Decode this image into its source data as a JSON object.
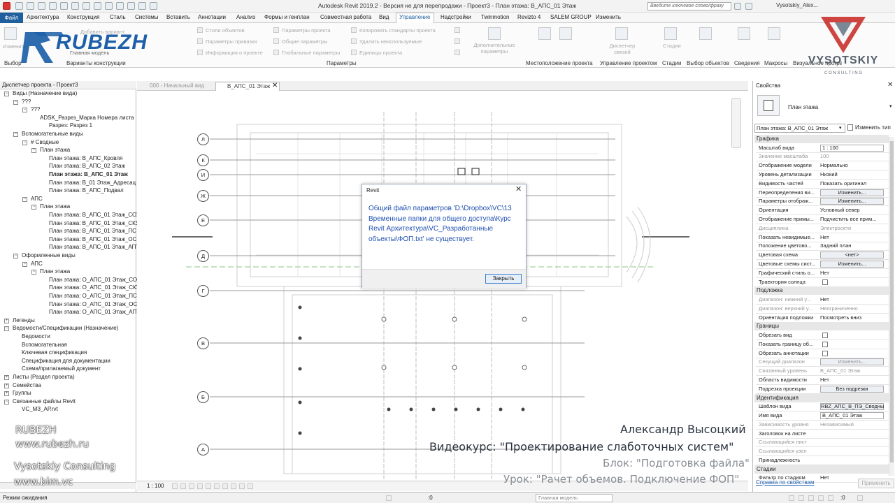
{
  "window": {
    "title": "Autodesk Revit 2019.2 - Версия не для перепродажи - Проект3 - План этажа: В_АПС_01 Этаж",
    "search_placeholder": "Введите ключевое слово/фразу",
    "user": "Vysotskiy_Alex..."
  },
  "menu": {
    "file": "Файл",
    "tabs": [
      "Архитектура",
      "Конструкция",
      "Сталь",
      "Системы",
      "Вставить",
      "Аннотации",
      "Анализ",
      "Формы и генплан",
      "Совместная работа",
      "Вид",
      "Управление",
      "Надстройки",
      "Twinmotion",
      "Revizto 4",
      "SALEM GROUP",
      "Изменить"
    ],
    "active": "Управление"
  },
  "ribbon": {
    "items": [
      "Изменить",
      "Добавить вариант",
      "Главная модель",
      "Стили объектов",
      "Параметры привязки",
      "Информация о проекте",
      "Параметры проекта",
      "Общие параметры",
      "Глобальные параметры",
      "Копировать стандарты проекта",
      "Удалить неиспользуемые",
      "Единицы проекта",
      "Дополнительные параметры",
      "Диспетчер связей",
      "Стадии",
      "Выбор объектов",
      "Сведения",
      "Макросы",
      "Визуальное программирование"
    ],
    "groups": [
      "Выбор",
      "Варианты конструкции",
      "Параметры",
      "Местоположение проекта",
      "Управление проектом",
      "Стадии",
      "Выбор объектов",
      "Сведения",
      "Макросы",
      "Визуальное программирование"
    ]
  },
  "logo": {
    "rubezh": "RUBEZH",
    "vysotskiy": "VYSOTSKIY",
    "consulting": "C O N S U L T I N G"
  },
  "browser": {
    "title": "Диспетчер проекта - Проект3",
    "nodes": [
      "Виды (Назначение вида)",
      "???",
      "???",
      "ADSK_Разрез_Марка Номера листа",
      "Разрез: Разрез 1",
      "Вспомогательные виды",
      "# Сводные",
      "План этажа",
      "План этажа: В_АПС_Кровля",
      "План этажа: В_АПС_02 Этаж",
      "План этажа: В_АПС_01 Этаж",
      "План этажа: В_01 Этаж_Адресац",
      "План этажа: В_АПС_Подвал",
      "АПС",
      "План этажа",
      "План этажа: В_АПС_01 Этаж_СОУ",
      "План этажа: В_АПС_01 Этаж_СКУ",
      "План этажа: В_АПС_01 Этаж_ПС",
      "План этажа: В_АПС_01 Этаж_ОС",
      "План этажа: В_АПС_01 Этаж_АПТ",
      "Оформленные виды",
      "АПС",
      "План этажа",
      "План этажа: О_АПС_01 Этаж_СОУ",
      "План этажа: О_АПС_01 Этаж_СКУ",
      "План этажа: О_АПС_01 Этаж_ПС",
      "План этажа: О_АПС_01 Этаж_ОС",
      "План этажа: О_АПС_01 Этаж_АПТ",
      "Легенды",
      "Ведомости/Спецификации (Назначение)",
      "Ведомости",
      "Вспомогательная",
      "Ключевая спецификация",
      "Спецификация для документации",
      "Схема/прилагаемый документ",
      "Листы (Раздел проекта)",
      "Семейства",
      "Группы",
      "Связанные файлы Revit",
      "VC_МЗ_АР.rvt"
    ]
  },
  "views": {
    "tabs": [
      "000 - Начальный вид",
      "В_АПС_01 Этаж"
    ],
    "scale": "1 : 100",
    "grid_labels": [
      "Л",
      "К",
      "И",
      "Ж",
      "Е",
      "Д",
      "Г",
      "В",
      "Б",
      "А"
    ]
  },
  "dialog": {
    "title": "Revit",
    "message": "Общий файл параметров 'D:\\Dropbox\\VC\\13 Временные папки для общего доступа\\Курс Revit Архитектура\\VC_Разработанные объекты\\ФОП.txt' не существует.",
    "button": "Закрыть"
  },
  "properties": {
    "title": "Свойства",
    "type": "План этажа",
    "selector": "План этажа: В_АПС_01 Этаж",
    "edit_type": "Изменить тип",
    "categories": {
      "graphics": "Графика",
      "underlay": "Подложка",
      "extents": "Границы",
      "identity": "Идентификация",
      "phasing": "Стадии"
    },
    "rows": [
      {
        "label": "Масштаб вида",
        "value": "1 : 100",
        "kind": "input"
      },
      {
        "label": "Значение масштаба",
        "value": "100",
        "kind": "dim"
      },
      {
        "label": "Отображение модели",
        "value": "Нормально",
        "kind": "text"
      },
      {
        "label": "Уровень детализации",
        "value": "Низкий",
        "kind": "text"
      },
      {
        "label": "Видимость частей",
        "value": "Показать оригинал",
        "kind": "text"
      },
      {
        "label": "Переопределения ви...",
        "value": "Изменить...",
        "kind": "button"
      },
      {
        "label": "Параметры отображ...",
        "value": "Изменить...",
        "kind": "button"
      },
      {
        "label": "Ориентация",
        "value": "Условный север",
        "kind": "text"
      },
      {
        "label": "Отображение примы...",
        "value": "Подчистить все прим...",
        "kind": "text"
      },
      {
        "label": "Дисциплина",
        "value": "Электросети",
        "kind": "dim"
      },
      {
        "label": "Показать невидимые...",
        "value": "Нет",
        "kind": "text"
      },
      {
        "label": "Положение цветово...",
        "value": "Задний план",
        "kind": "text"
      },
      {
        "label": "Цветовая схема",
        "value": "<нет>",
        "kind": "button"
      },
      {
        "label": "Цветовые схемы сист...",
        "value": "Изменить...",
        "kind": "button"
      },
      {
        "label": "Графический стиль о...",
        "value": "Нет",
        "kind": "text"
      },
      {
        "label": "Траектория солнца",
        "value": "",
        "kind": "check"
      },
      {
        "label": "Диапазон: нижний у...",
        "value": "Нет",
        "kind": "dimlabel"
      },
      {
        "label": "Диапазон: верхний у...",
        "value": "Неограниченно",
        "kind": "dim"
      },
      {
        "label": "Ориентация подложки",
        "value": "Посмотреть вниз",
        "kind": "text"
      },
      {
        "label": "Обрезать вид",
        "value": "",
        "kind": "check"
      },
      {
        "label": "Показать границу об...",
        "value": "",
        "kind": "check"
      },
      {
        "label": "Обрезать аннотации",
        "value": "",
        "kind": "check"
      },
      {
        "label": "Секущий диапазон",
        "value": "Изменить...",
        "kind": "dimbutton"
      },
      {
        "label": "Связанный уровень",
        "value": "В_АПС_01 Этаж",
        "kind": "dim"
      },
      {
        "label": "Область видимости",
        "value": "Нет",
        "kind": "text"
      },
      {
        "label": "Подрезка проекции",
        "value": "Без подрезки",
        "kind": "button"
      },
      {
        "label": "Шаблон вида",
        "value": "RBZ_АПС_В_ПЭ_Сводны",
        "kind": "button"
      },
      {
        "label": "Имя вида",
        "value": "В_АПС_01 Этаж",
        "kind": "input"
      },
      {
        "label": "Зависимость уровня",
        "value": "Независимый",
        "kind": "dim"
      },
      {
        "label": "Заголовок на листе",
        "value": "",
        "kind": "text"
      },
      {
        "label": "Ссылающийся лист",
        "value": "",
        "kind": "dim"
      },
      {
        "label": "Ссылающийся узел",
        "value": "",
        "kind": "dim"
      },
      {
        "label": "Принадлежность",
        "value": "",
        "kind": "text"
      },
      {
        "label": "Фильтр по стадиям",
        "value": "Нет",
        "kind": "text"
      }
    ],
    "help_link": "Справка по свойствам",
    "apply": "Применить"
  },
  "overlay": {
    "left_lines": [
      "RUBEZH",
      "www.rubezh.ru",
      "Vysotskiy Consulting",
      "www.bim.vc"
    ],
    "author": "Александр Высоцкий",
    "course": "Видеокурс: \"Проектирование слаботочных систем\"",
    "block": "Блок: \"Подготовка файла\"",
    "lesson": "Урок: \"Рачет объемов. Подключение ФОП\""
  },
  "status": {
    "text": "Режим ожидания",
    "model": "Главная модель",
    "zero": ":0"
  }
}
